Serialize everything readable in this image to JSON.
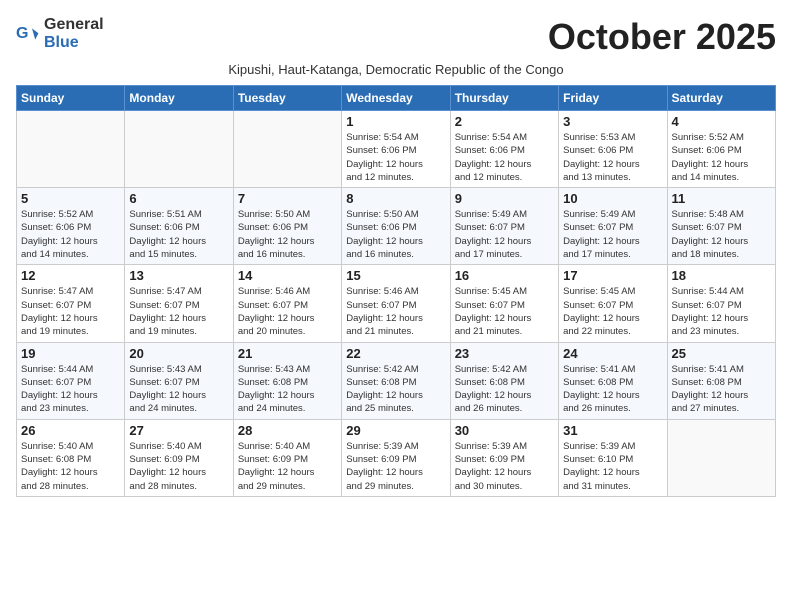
{
  "logo": {
    "general": "General",
    "blue": "Blue"
  },
  "header": {
    "title": "October 2025",
    "subtitle": "Kipushi, Haut-Katanga, Democratic Republic of the Congo"
  },
  "weekdays": [
    "Sunday",
    "Monday",
    "Tuesday",
    "Wednesday",
    "Thursday",
    "Friday",
    "Saturday"
  ],
  "weeks": [
    [
      {
        "day": "",
        "info": ""
      },
      {
        "day": "",
        "info": ""
      },
      {
        "day": "",
        "info": ""
      },
      {
        "day": "1",
        "info": "Sunrise: 5:54 AM\nSunset: 6:06 PM\nDaylight: 12 hours\nand 12 minutes."
      },
      {
        "day": "2",
        "info": "Sunrise: 5:54 AM\nSunset: 6:06 PM\nDaylight: 12 hours\nand 12 minutes."
      },
      {
        "day": "3",
        "info": "Sunrise: 5:53 AM\nSunset: 6:06 PM\nDaylight: 12 hours\nand 13 minutes."
      },
      {
        "day": "4",
        "info": "Sunrise: 5:52 AM\nSunset: 6:06 PM\nDaylight: 12 hours\nand 14 minutes."
      }
    ],
    [
      {
        "day": "5",
        "info": "Sunrise: 5:52 AM\nSunset: 6:06 PM\nDaylight: 12 hours\nand 14 minutes."
      },
      {
        "day": "6",
        "info": "Sunrise: 5:51 AM\nSunset: 6:06 PM\nDaylight: 12 hours\nand 15 minutes."
      },
      {
        "day": "7",
        "info": "Sunrise: 5:50 AM\nSunset: 6:06 PM\nDaylight: 12 hours\nand 16 minutes."
      },
      {
        "day": "8",
        "info": "Sunrise: 5:50 AM\nSunset: 6:06 PM\nDaylight: 12 hours\nand 16 minutes."
      },
      {
        "day": "9",
        "info": "Sunrise: 5:49 AM\nSunset: 6:07 PM\nDaylight: 12 hours\nand 17 minutes."
      },
      {
        "day": "10",
        "info": "Sunrise: 5:49 AM\nSunset: 6:07 PM\nDaylight: 12 hours\nand 17 minutes."
      },
      {
        "day": "11",
        "info": "Sunrise: 5:48 AM\nSunset: 6:07 PM\nDaylight: 12 hours\nand 18 minutes."
      }
    ],
    [
      {
        "day": "12",
        "info": "Sunrise: 5:47 AM\nSunset: 6:07 PM\nDaylight: 12 hours\nand 19 minutes."
      },
      {
        "day": "13",
        "info": "Sunrise: 5:47 AM\nSunset: 6:07 PM\nDaylight: 12 hours\nand 19 minutes."
      },
      {
        "day": "14",
        "info": "Sunrise: 5:46 AM\nSunset: 6:07 PM\nDaylight: 12 hours\nand 20 minutes."
      },
      {
        "day": "15",
        "info": "Sunrise: 5:46 AM\nSunset: 6:07 PM\nDaylight: 12 hours\nand 21 minutes."
      },
      {
        "day": "16",
        "info": "Sunrise: 5:45 AM\nSunset: 6:07 PM\nDaylight: 12 hours\nand 21 minutes."
      },
      {
        "day": "17",
        "info": "Sunrise: 5:45 AM\nSunset: 6:07 PM\nDaylight: 12 hours\nand 22 minutes."
      },
      {
        "day": "18",
        "info": "Sunrise: 5:44 AM\nSunset: 6:07 PM\nDaylight: 12 hours\nand 23 minutes."
      }
    ],
    [
      {
        "day": "19",
        "info": "Sunrise: 5:44 AM\nSunset: 6:07 PM\nDaylight: 12 hours\nand 23 minutes."
      },
      {
        "day": "20",
        "info": "Sunrise: 5:43 AM\nSunset: 6:07 PM\nDaylight: 12 hours\nand 24 minutes."
      },
      {
        "day": "21",
        "info": "Sunrise: 5:43 AM\nSunset: 6:08 PM\nDaylight: 12 hours\nand 24 minutes."
      },
      {
        "day": "22",
        "info": "Sunrise: 5:42 AM\nSunset: 6:08 PM\nDaylight: 12 hours\nand 25 minutes."
      },
      {
        "day": "23",
        "info": "Sunrise: 5:42 AM\nSunset: 6:08 PM\nDaylight: 12 hours\nand 26 minutes."
      },
      {
        "day": "24",
        "info": "Sunrise: 5:41 AM\nSunset: 6:08 PM\nDaylight: 12 hours\nand 26 minutes."
      },
      {
        "day": "25",
        "info": "Sunrise: 5:41 AM\nSunset: 6:08 PM\nDaylight: 12 hours\nand 27 minutes."
      }
    ],
    [
      {
        "day": "26",
        "info": "Sunrise: 5:40 AM\nSunset: 6:08 PM\nDaylight: 12 hours\nand 28 minutes."
      },
      {
        "day": "27",
        "info": "Sunrise: 5:40 AM\nSunset: 6:09 PM\nDaylight: 12 hours\nand 28 minutes."
      },
      {
        "day": "28",
        "info": "Sunrise: 5:40 AM\nSunset: 6:09 PM\nDaylight: 12 hours\nand 29 minutes."
      },
      {
        "day": "29",
        "info": "Sunrise: 5:39 AM\nSunset: 6:09 PM\nDaylight: 12 hours\nand 29 minutes."
      },
      {
        "day": "30",
        "info": "Sunrise: 5:39 AM\nSunset: 6:09 PM\nDaylight: 12 hours\nand 30 minutes."
      },
      {
        "day": "31",
        "info": "Sunrise: 5:39 AM\nSunset: 6:10 PM\nDaylight: 12 hours\nand 31 minutes."
      },
      {
        "day": "",
        "info": ""
      }
    ]
  ]
}
